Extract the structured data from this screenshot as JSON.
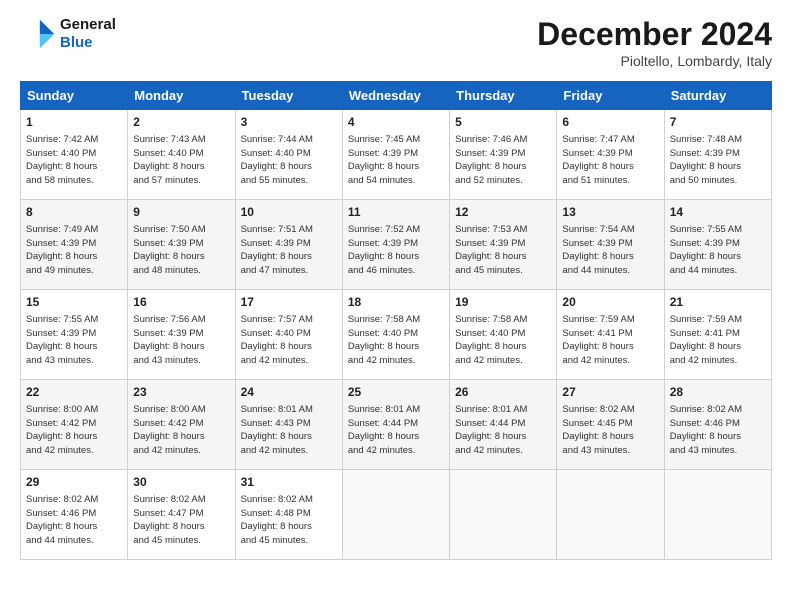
{
  "header": {
    "logo_line1": "General",
    "logo_line2": "Blue",
    "month": "December 2024",
    "location": "Pioltello, Lombardy, Italy"
  },
  "weekdays": [
    "Sunday",
    "Monday",
    "Tuesday",
    "Wednesday",
    "Thursday",
    "Friday",
    "Saturday"
  ],
  "weeks": [
    [
      {
        "day": "1",
        "info": "Sunrise: 7:42 AM\nSunset: 4:40 PM\nDaylight: 8 hours\nand 58 minutes."
      },
      {
        "day": "2",
        "info": "Sunrise: 7:43 AM\nSunset: 4:40 PM\nDaylight: 8 hours\nand 57 minutes."
      },
      {
        "day": "3",
        "info": "Sunrise: 7:44 AM\nSunset: 4:40 PM\nDaylight: 8 hours\nand 55 minutes."
      },
      {
        "day": "4",
        "info": "Sunrise: 7:45 AM\nSunset: 4:39 PM\nDaylight: 8 hours\nand 54 minutes."
      },
      {
        "day": "5",
        "info": "Sunrise: 7:46 AM\nSunset: 4:39 PM\nDaylight: 8 hours\nand 52 minutes."
      },
      {
        "day": "6",
        "info": "Sunrise: 7:47 AM\nSunset: 4:39 PM\nDaylight: 8 hours\nand 51 minutes."
      },
      {
        "day": "7",
        "info": "Sunrise: 7:48 AM\nSunset: 4:39 PM\nDaylight: 8 hours\nand 50 minutes."
      }
    ],
    [
      {
        "day": "8",
        "info": "Sunrise: 7:49 AM\nSunset: 4:39 PM\nDaylight: 8 hours\nand 49 minutes."
      },
      {
        "day": "9",
        "info": "Sunrise: 7:50 AM\nSunset: 4:39 PM\nDaylight: 8 hours\nand 48 minutes."
      },
      {
        "day": "10",
        "info": "Sunrise: 7:51 AM\nSunset: 4:39 PM\nDaylight: 8 hours\nand 47 minutes."
      },
      {
        "day": "11",
        "info": "Sunrise: 7:52 AM\nSunset: 4:39 PM\nDaylight: 8 hours\nand 46 minutes."
      },
      {
        "day": "12",
        "info": "Sunrise: 7:53 AM\nSunset: 4:39 PM\nDaylight: 8 hours\nand 45 minutes."
      },
      {
        "day": "13",
        "info": "Sunrise: 7:54 AM\nSunset: 4:39 PM\nDaylight: 8 hours\nand 44 minutes."
      },
      {
        "day": "14",
        "info": "Sunrise: 7:55 AM\nSunset: 4:39 PM\nDaylight: 8 hours\nand 44 minutes."
      }
    ],
    [
      {
        "day": "15",
        "info": "Sunrise: 7:55 AM\nSunset: 4:39 PM\nDaylight: 8 hours\nand 43 minutes."
      },
      {
        "day": "16",
        "info": "Sunrise: 7:56 AM\nSunset: 4:39 PM\nDaylight: 8 hours\nand 43 minutes."
      },
      {
        "day": "17",
        "info": "Sunrise: 7:57 AM\nSunset: 4:40 PM\nDaylight: 8 hours\nand 42 minutes."
      },
      {
        "day": "18",
        "info": "Sunrise: 7:58 AM\nSunset: 4:40 PM\nDaylight: 8 hours\nand 42 minutes."
      },
      {
        "day": "19",
        "info": "Sunrise: 7:58 AM\nSunset: 4:40 PM\nDaylight: 8 hours\nand 42 minutes."
      },
      {
        "day": "20",
        "info": "Sunrise: 7:59 AM\nSunset: 4:41 PM\nDaylight: 8 hours\nand 42 minutes."
      },
      {
        "day": "21",
        "info": "Sunrise: 7:59 AM\nSunset: 4:41 PM\nDaylight: 8 hours\nand 42 minutes."
      }
    ],
    [
      {
        "day": "22",
        "info": "Sunrise: 8:00 AM\nSunset: 4:42 PM\nDaylight: 8 hours\nand 42 minutes."
      },
      {
        "day": "23",
        "info": "Sunrise: 8:00 AM\nSunset: 4:42 PM\nDaylight: 8 hours\nand 42 minutes."
      },
      {
        "day": "24",
        "info": "Sunrise: 8:01 AM\nSunset: 4:43 PM\nDaylight: 8 hours\nand 42 minutes."
      },
      {
        "day": "25",
        "info": "Sunrise: 8:01 AM\nSunset: 4:44 PM\nDaylight: 8 hours\nand 42 minutes."
      },
      {
        "day": "26",
        "info": "Sunrise: 8:01 AM\nSunset: 4:44 PM\nDaylight: 8 hours\nand 42 minutes."
      },
      {
        "day": "27",
        "info": "Sunrise: 8:02 AM\nSunset: 4:45 PM\nDaylight: 8 hours\nand 43 minutes."
      },
      {
        "day": "28",
        "info": "Sunrise: 8:02 AM\nSunset: 4:46 PM\nDaylight: 8 hours\nand 43 minutes."
      }
    ],
    [
      {
        "day": "29",
        "info": "Sunrise: 8:02 AM\nSunset: 4:46 PM\nDaylight: 8 hours\nand 44 minutes."
      },
      {
        "day": "30",
        "info": "Sunrise: 8:02 AM\nSunset: 4:47 PM\nDaylight: 8 hours\nand 45 minutes."
      },
      {
        "day": "31",
        "info": "Sunrise: 8:02 AM\nSunset: 4:48 PM\nDaylight: 8 hours\nand 45 minutes."
      },
      null,
      null,
      null,
      null
    ]
  ]
}
